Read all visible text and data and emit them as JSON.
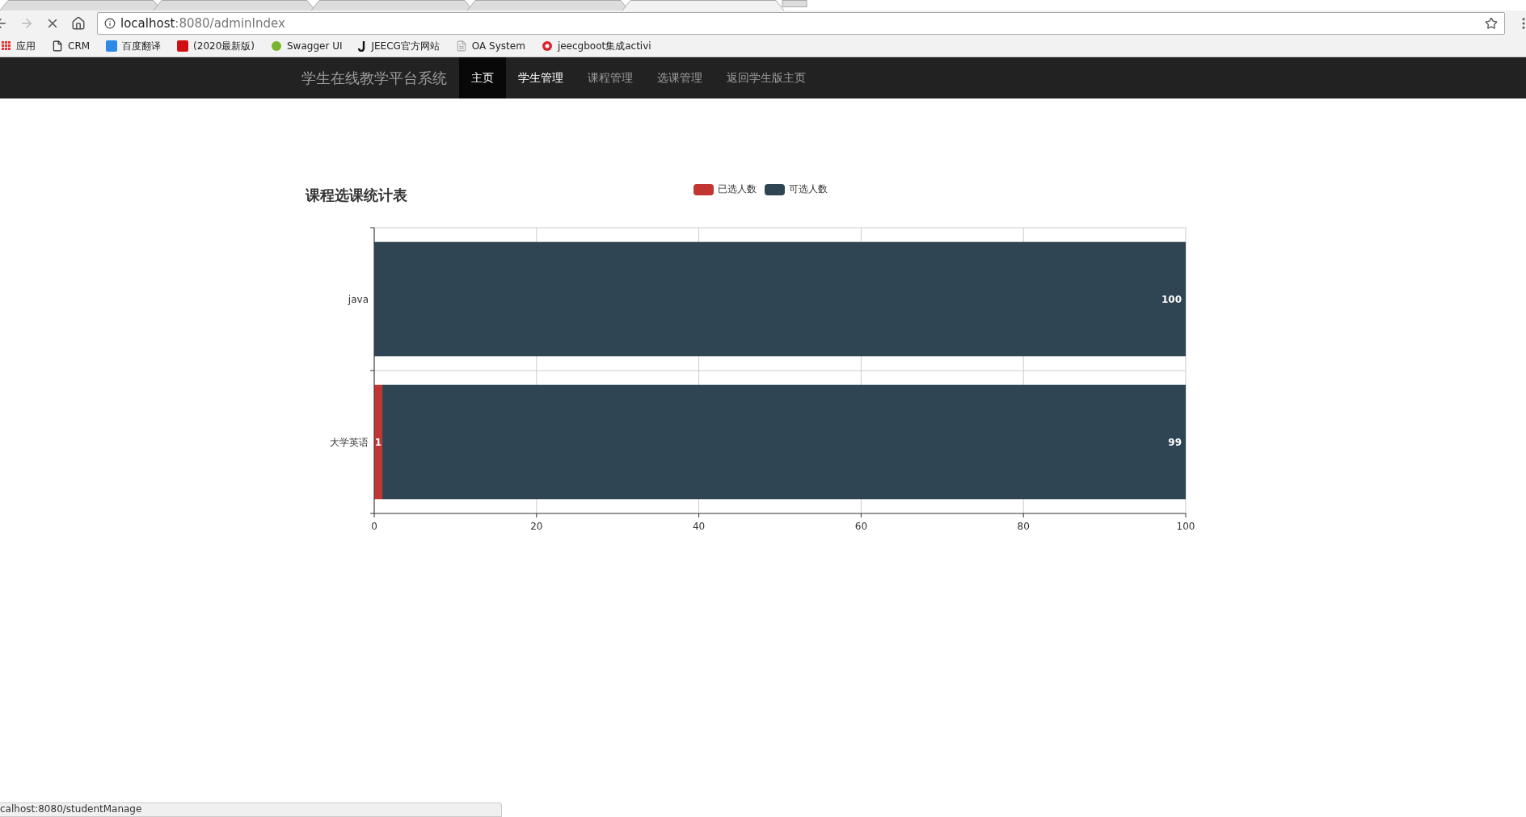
{
  "browser": {
    "url_host": "localhost",
    "url_rest": ":8080/adminIndex",
    "loading": true,
    "bookmarks": [
      {
        "kind": "apps",
        "label": "应用"
      },
      {
        "kind": "page",
        "label": "CRM"
      },
      {
        "kind": "translate",
        "label": "百度翻译"
      },
      {
        "kind": "red",
        "label": "(2020最新版)"
      },
      {
        "kind": "green",
        "label": "Swagger UI"
      },
      {
        "kind": "j",
        "label": "JEECG官方网站"
      },
      {
        "kind": "doc",
        "label": "OA System"
      },
      {
        "kind": "g",
        "label": "jeecgboot集成activi"
      }
    ]
  },
  "navbar": {
    "brand": "学生在线教学平台系统",
    "items": [
      {
        "label": "主页",
        "selected": true,
        "hovered": false
      },
      {
        "label": "学生管理",
        "selected": false,
        "hovered": true
      },
      {
        "label": "课程管理",
        "selected": false,
        "hovered": false
      },
      {
        "label": "选课管理",
        "selected": false,
        "hovered": false
      },
      {
        "label": "返回学生版主页",
        "selected": false,
        "hovered": false
      }
    ]
  },
  "chart": {
    "chart_data": {
      "type": "bar",
      "title": "课程选课统计表",
      "orientation": "horizontal",
      "stacked": true,
      "grid": true,
      "legend": "top",
      "value_labels": [
        [
          null,
          "1"
        ],
        [
          "100",
          "99"
        ]
      ],
      "categories": [
        "java",
        "大学英语"
      ],
      "series": [
        {
          "name": "已选人数",
          "color": "#c23531",
          "values": [
            0,
            1
          ]
        },
        {
          "name": "可选人数",
          "color": "#2f4554",
          "values": [
            100,
            99
          ]
        }
      ],
      "xlim": [
        0,
        100
      ],
      "xticks": [
        0,
        20,
        40,
        60,
        80,
        100
      ]
    }
  },
  "status_bar": "calhost:8080/studentManage"
}
